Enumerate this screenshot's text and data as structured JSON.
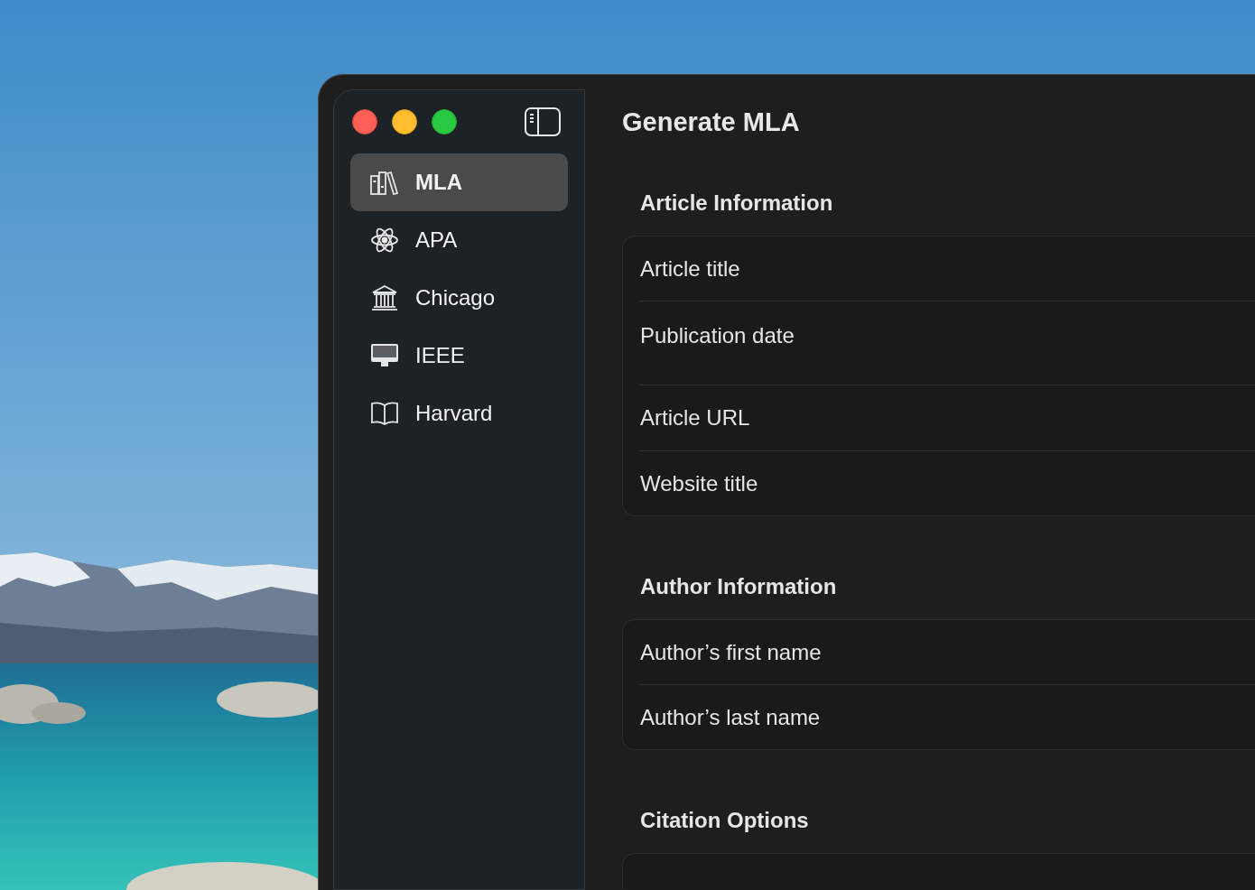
{
  "window": {
    "title": "Generate MLA"
  },
  "sidebar": {
    "items": [
      {
        "label": "MLA",
        "kind": "books",
        "selected": true
      },
      {
        "label": "APA",
        "kind": "atom",
        "selected": false
      },
      {
        "label": "Chicago",
        "kind": "building",
        "selected": false
      },
      {
        "label": "IEEE",
        "kind": "monitor",
        "selected": false
      },
      {
        "label": "Harvard",
        "kind": "book",
        "selected": false
      }
    ]
  },
  "sections": [
    {
      "title": "Article Information",
      "rows": [
        {
          "kind": "text",
          "placeholder": "Article title"
        },
        {
          "kind": "date",
          "label": "Publication date"
        },
        {
          "kind": "text",
          "placeholder": "Article URL"
        },
        {
          "kind": "text",
          "placeholder": "Website title"
        }
      ]
    },
    {
      "title": "Author Information",
      "rows": [
        {
          "kind": "text",
          "placeholder": "Author’s first name"
        },
        {
          "kind": "text",
          "placeholder": "Author’s last name"
        }
      ]
    },
    {
      "title": "Citation Options"
    }
  ]
}
